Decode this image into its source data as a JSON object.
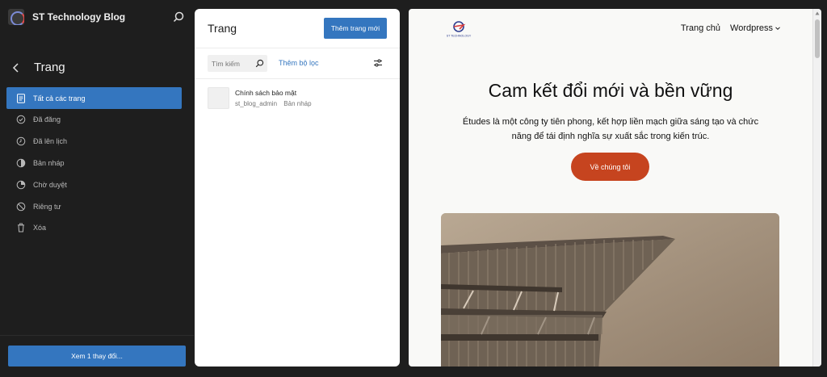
{
  "site": {
    "name": "ST Technology Blog"
  },
  "sidebar": {
    "section_title": "Trang",
    "items": [
      {
        "label": "Tất cả các trang",
        "icon": "pages-icon",
        "active": true
      },
      {
        "label": "Đã đăng",
        "icon": "published-icon"
      },
      {
        "label": "Đã lên lịch",
        "icon": "scheduled-icon"
      },
      {
        "label": "Bản nháp",
        "icon": "draft-icon"
      },
      {
        "label": "Chờ duyệt",
        "icon": "pending-icon"
      },
      {
        "label": "Riêng tư",
        "icon": "private-icon"
      },
      {
        "label": "Xóa",
        "icon": "trash-icon"
      }
    ],
    "save_label": "Xem 1 thay đổi..."
  },
  "pages_panel": {
    "title": "Trang",
    "add_button": "Thêm trang mới",
    "search_placeholder": "Tìm kiếm",
    "add_filter": "Thêm bộ lọc",
    "rows": [
      {
        "title": "Chính sách bảo mật",
        "author": "st_blog_admin",
        "status": "Bản nháp"
      }
    ]
  },
  "preview": {
    "logo_text": "ST TECHNOLOGY",
    "nav": {
      "home": "Trang chủ",
      "wordpress": "Wordpress"
    },
    "headline": "Cam kết đổi mới và bền vững",
    "subtitle": "Études là một công ty tiên phong, kết hợp liền mạch giữa sáng tạo và chức năng để tái định nghĩa sự xuất sắc trong kiến trúc.",
    "cta": "Về chúng tôi"
  },
  "colors": {
    "accent": "#3476bf",
    "cta": "#c6441f",
    "sidebar_bg": "#1e1e1e"
  }
}
